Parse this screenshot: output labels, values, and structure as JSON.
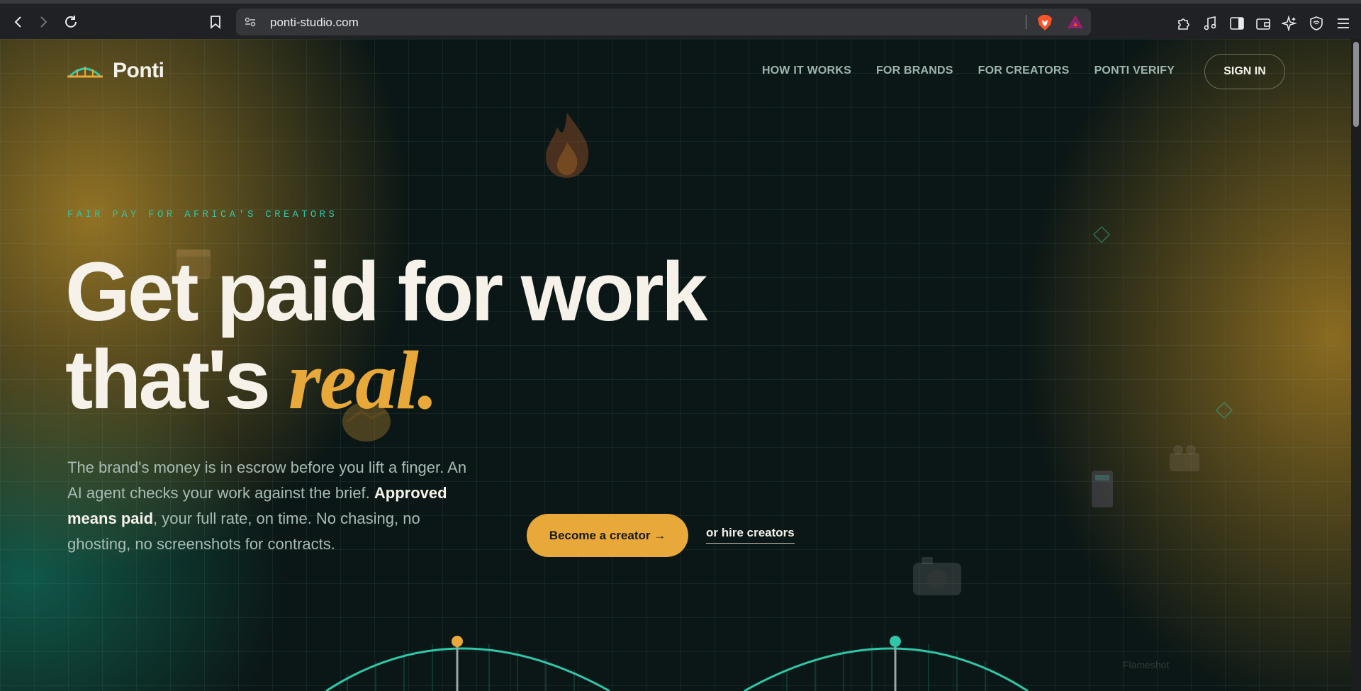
{
  "browser": {
    "url": "ponti-studio.com"
  },
  "site": {
    "brand": "Ponti",
    "nav": [
      {
        "label": "HOW IT WORKS"
      },
      {
        "label": "FOR BRANDS"
      },
      {
        "label": "FOR CREATORS"
      },
      {
        "label": "PONTI VERIFY"
      }
    ],
    "sign_in": "SIGN IN"
  },
  "hero": {
    "eyebrow": "FAIR PAY FOR AFRICA'S CREATORS",
    "headline_line1": "Get paid for work",
    "headline_line2_prefix": "that's ",
    "headline_accent": "real.",
    "sub_part1": "The brand's money is in escrow before you lift a finger. An AI agent checks your work against the brief. ",
    "sub_bold": "Approved means paid",
    "sub_part2": ", your full rate, on time. No chasing, no ghosting, no screenshots for contracts.",
    "cta_primary": "Become a creator →",
    "cta_secondary": "or hire creators"
  },
  "watermark": "Flameshot",
  "colors": {
    "accent": "#e8a83a",
    "teal": "#2fc7a8",
    "background": "#0b1716"
  }
}
